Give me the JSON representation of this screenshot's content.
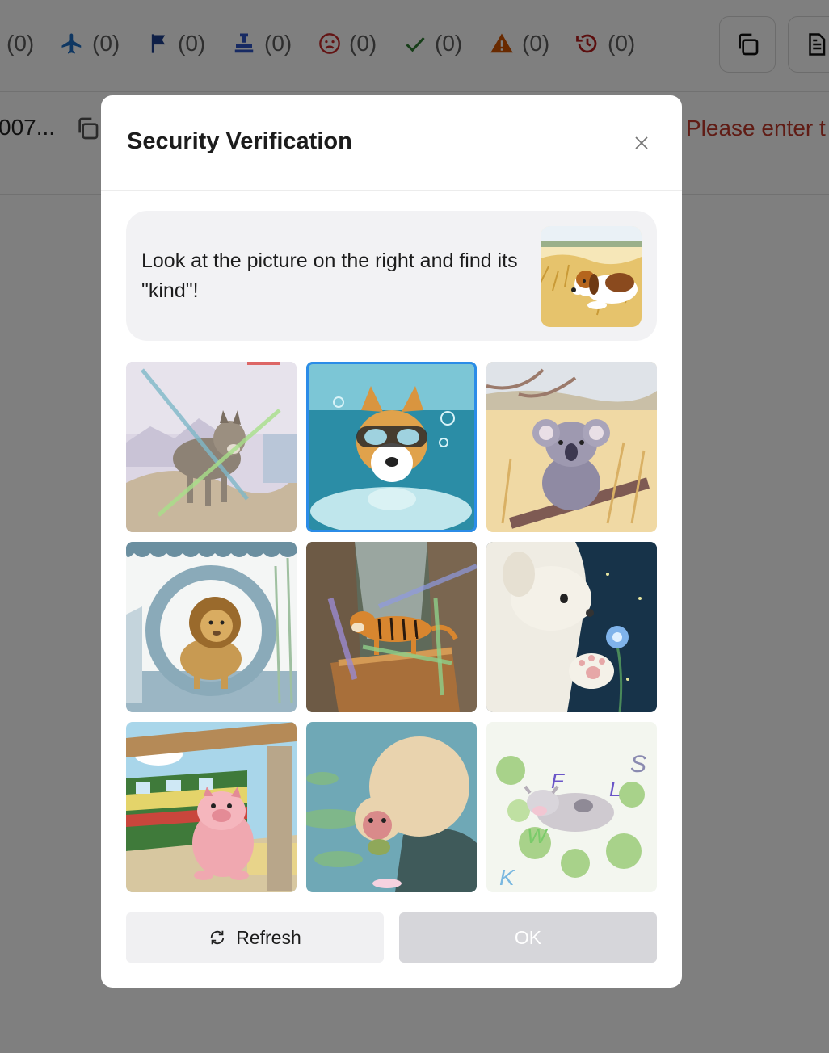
{
  "stats": [
    {
      "icon": "list-icon",
      "count": "(0)",
      "color": "#5c5c5c"
    },
    {
      "icon": "airplane-icon",
      "count": "(0)",
      "color": "#1f6fc4"
    },
    {
      "icon": "flag-icon",
      "count": "(0)",
      "color": "#1d3f8f"
    },
    {
      "icon": "stamp-icon",
      "count": "(0)",
      "color": "#2f55c7"
    },
    {
      "icon": "sad-face-icon",
      "count": "(0)",
      "color": "#c62828"
    },
    {
      "icon": "checkmark-icon",
      "count": "(0)",
      "color": "#2e7d32"
    },
    {
      "icon": "warning-icon",
      "count": "(0)",
      "color": "#d35400"
    },
    {
      "icon": "history-icon",
      "count": "(0)",
      "color": "#b71c1c"
    }
  ],
  "row": {
    "id_text": "007...",
    "message": "Please enter t"
  },
  "modal": {
    "title": "Security Verification",
    "prompt": "Look at the picture on the right and find its \"kind\"!",
    "reference_image": "beagle-in-wheat-field",
    "tiles": [
      {
        "subject": "wolf",
        "selected": false
      },
      {
        "subject": "corgi-underwater",
        "selected": true
      },
      {
        "subject": "koala",
        "selected": false
      },
      {
        "subject": "lion",
        "selected": false
      },
      {
        "subject": "tiger",
        "selected": false
      },
      {
        "subject": "white-puppy",
        "selected": false
      },
      {
        "subject": "pig-at-train-station",
        "selected": false
      },
      {
        "subject": "monkey",
        "selected": false
      },
      {
        "subject": "cow-with-letters",
        "selected": false
      }
    ],
    "tile_letters": [
      "F",
      "L",
      "S",
      "W",
      "K"
    ],
    "refresh_label": "Refresh",
    "ok_label": "OK"
  },
  "colors": {
    "accent": "#2b8ce8",
    "error_text": "#c0392b",
    "ok_disabled": "#d6d6da"
  }
}
